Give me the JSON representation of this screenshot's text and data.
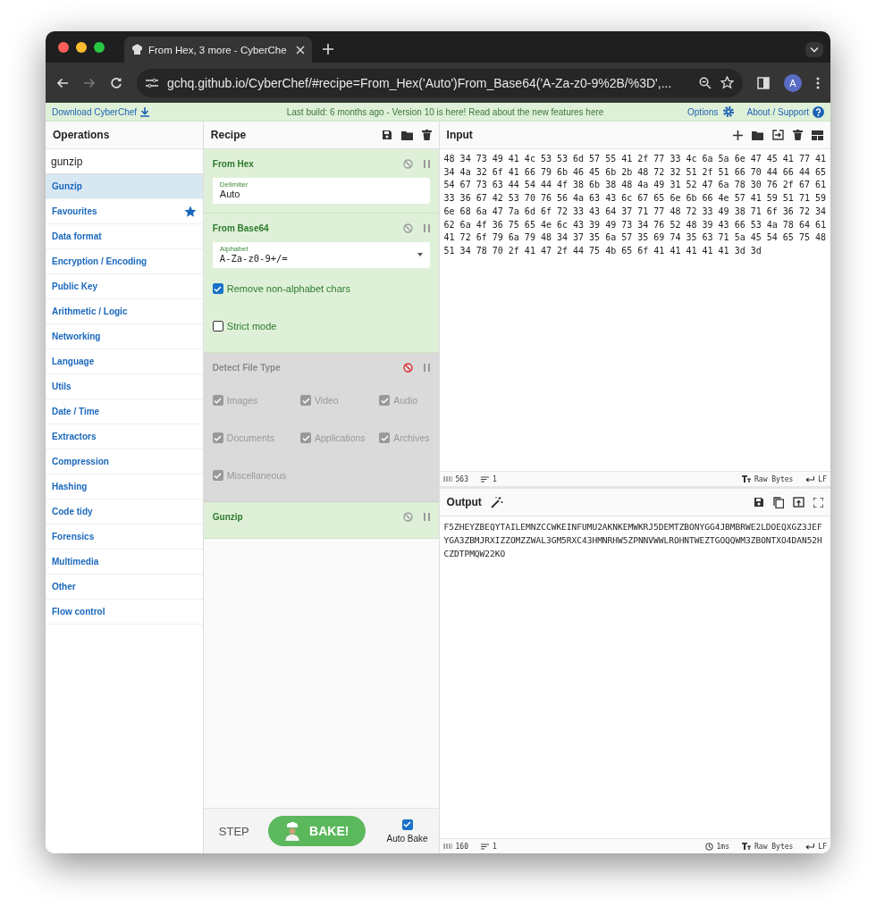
{
  "browser": {
    "tab_title": "From Hex, 3 more - CyberChe",
    "url": "gchq.github.io/CyberChef/#recipe=From_Hex('Auto')From_Base64('A-Za-z0-9%2B/%3D',...",
    "profile": "A"
  },
  "banner": {
    "download": "Download CyberChef",
    "message": "Last build: 6 months ago - Version 10 is here! Read about the new features here",
    "options": "Options",
    "about": "About / Support"
  },
  "operations": {
    "title": "Operations",
    "search": "gunzip",
    "items": [
      {
        "label": "Gunzip",
        "selected": true,
        "starred": false
      },
      {
        "label": "Favourites",
        "selected": false,
        "starred": true
      },
      {
        "label": "Data format",
        "selected": false,
        "starred": false
      },
      {
        "label": "Encryption / Encoding",
        "selected": false,
        "starred": false
      },
      {
        "label": "Public Key",
        "selected": false,
        "starred": false
      },
      {
        "label": "Arithmetic / Logic",
        "selected": false,
        "starred": false
      },
      {
        "label": "Networking",
        "selected": false,
        "starred": false
      },
      {
        "label": "Language",
        "selected": false,
        "starred": false
      },
      {
        "label": "Utils",
        "selected": false,
        "starred": false
      },
      {
        "label": "Date / Time",
        "selected": false,
        "starred": false
      },
      {
        "label": "Extractors",
        "selected": false,
        "starred": false
      },
      {
        "label": "Compression",
        "selected": false,
        "starred": false
      },
      {
        "label": "Hashing",
        "selected": false,
        "starred": false
      },
      {
        "label": "Code tidy",
        "selected": false,
        "starred": false
      },
      {
        "label": "Forensics",
        "selected": false,
        "starred": false
      },
      {
        "label": "Multimedia",
        "selected": false,
        "starred": false
      },
      {
        "label": "Other",
        "selected": false,
        "starred": false
      },
      {
        "label": "Flow control",
        "selected": false,
        "starred": false
      }
    ]
  },
  "recipe": {
    "title": "Recipe",
    "ops": [
      {
        "name": "From Hex",
        "disabled": false,
        "args": [
          {
            "kind": "text",
            "label": "Delimiter",
            "value": "Auto"
          }
        ]
      },
      {
        "name": "From Base64",
        "disabled": false,
        "args": [
          {
            "kind": "select",
            "label": "Alphabet",
            "value": "A-Za-z0-9+/="
          },
          {
            "kind": "checkbox",
            "label": "Remove non-alphabet chars",
            "checked": true
          },
          {
            "kind": "checkbox",
            "label": "Strict mode",
            "checked": false
          }
        ]
      },
      {
        "name": "Detect File Type",
        "disabled": true,
        "args": [
          {
            "kind": "option",
            "label": "Images",
            "checked": true
          },
          {
            "kind": "option",
            "label": "Video",
            "checked": true
          },
          {
            "kind": "option",
            "label": "Audio",
            "checked": true
          },
          {
            "kind": "option",
            "label": "Documents",
            "checked": true
          },
          {
            "kind": "option",
            "label": "Applications",
            "checked": true
          },
          {
            "kind": "option",
            "label": "Archives",
            "checked": true
          },
          {
            "kind": "option",
            "label": "Miscellaneous",
            "checked": true
          }
        ]
      },
      {
        "name": "Gunzip",
        "disabled": false
      }
    ]
  },
  "controls": {
    "step": "STEP",
    "bake": "BAKE!",
    "auto_bake": {
      "label": "Auto Bake",
      "checked": true
    }
  },
  "input": {
    "title": "Input",
    "text": "48 34 73 49 41 4c 53 53 6d 57 55 41 2f 77 33 4c 6a 5a 6e 47 45 41 77 41 34 4a 32 6f 41 66 79 6b 46 45 6b 2b 48 72 32 51 2f 51 66 70 44 66 44 65 54 67 73 63 44 54 44 4f 38 6b 38 48 4a 49 31 52 47 6a 78 30 76 2f 67 61 33 36 67 42 53 70 76 56 4a 63 43 6c 67 65 6e 6b 66 4e 57 41 59 51 71 59 6e 68 6a 47 7a 6d 6f 72 33 43 64 37 71 77 48 72 33 49 38 71 6f 36 72 34 62 6a 4f 36 75 65 4e 6c 43 39 49 73 34 76 52 48 39 43 66 53 4a 78 64 61 41 72 6f 79 6a 79 48 34 37 35 6a 57 35 69 74 35 63 71 5a 45 54 65 75 48 51 34 78 70 2f 41 47 2f 44 75 4b 65 6f 41 41 41 41 41 3d 3d",
    "status": {
      "length": "563",
      "lines": "1",
      "encoding": "Raw Bytes",
      "eol": "LF"
    }
  },
  "output": {
    "title": "Output",
    "text": "F5ZHEYZBEQYTAILEMNZCCWKEINFUMU2AKNKEMWKRJ5DEMTZBONYGG4JBMBRWE2LDOEQXGZ3JEFYGA3ZBMJRXIZZOMZZWAL3GM5RXC43HMNRHW5ZPNNVWWLROHNTWEZTGOQQWM3ZBONTXO4DAN52HCZDTPMQW22KO",
    "status": {
      "length": "160",
      "lines": "1",
      "time": "1ms",
      "encoding": "Raw Bytes",
      "eol": "LF"
    }
  }
}
